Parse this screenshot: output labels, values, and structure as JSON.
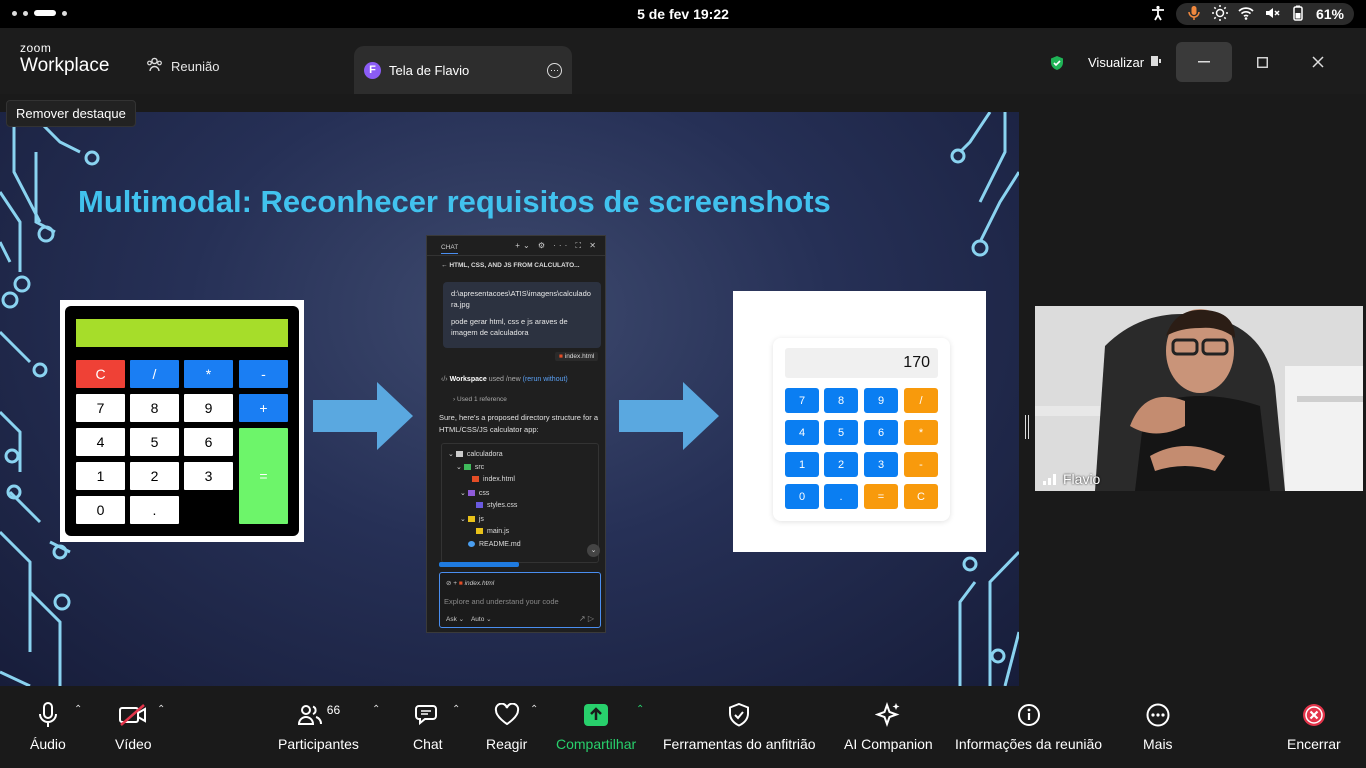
{
  "statusbar": {
    "clock": "5 de fev  19:22",
    "battery": "61%"
  },
  "titlebar": {
    "brand_small": "zoom",
    "brand_big": "Workplace",
    "tab_meeting": "Reunião",
    "tab_share_avatar": "F",
    "tab_share_label": "Tela de Flavio",
    "view_label": "Visualizar"
  },
  "tooltip": "Remover destaque",
  "slide": {
    "title": "Multimodal: Reconhecer requisitos de screenshots",
    "left_calc": {
      "keys": [
        "C",
        "/",
        "*",
        "-",
        "7",
        "8",
        "9",
        "+",
        "4",
        "5",
        "6",
        "=",
        "1",
        "2",
        "3",
        "0",
        "."
      ]
    },
    "chat": {
      "tab": "CHAT",
      "heading": "HTML, CSS, AND JS FROM CALCULATO...",
      "prompt_path": "d:\\apresentacoes\\ATIS\\imagens\\calculadora.jpg",
      "prompt_text": "pode gerar html, css e js araves de imagem de calculadora",
      "attachment": "index.html",
      "workspace": "Workspace",
      "workspace_used": "used /new",
      "workspace_link": "(rerun without)",
      "used_ref": "Used 1 reference",
      "reply": "Sure, here's a proposed directory structure for a HTML/CSS/JS calculator app:",
      "tree": [
        "calculadora",
        "src",
        "index.html",
        "css",
        "styles.css",
        "js",
        "main.js",
        "README.md"
      ],
      "input_chip": "index.html",
      "input_placeholder": "Explore and understand your code",
      "mode_ask": "Ask",
      "mode_auto": "Auto"
    },
    "right_calc": {
      "display": "170",
      "keys": [
        "7",
        "8",
        "9",
        "/",
        "4",
        "5",
        "6",
        "*",
        "1",
        "2",
        "3",
        "-",
        "0",
        ".",
        "=",
        "C"
      ]
    }
  },
  "video": {
    "name": "Flavio"
  },
  "toolbar": {
    "audio": "Áudio",
    "video": "Vídeo",
    "participants": "Participantes",
    "participants_count": "66",
    "chat": "Chat",
    "react": "Reagir",
    "share": "Compartilhar",
    "host_tools": "Ferramentas do anfitrião",
    "ai": "AI Companion",
    "info": "Informações da reunião",
    "more": "Mais",
    "end": "Encerrar"
  },
  "colors": {
    "share_green": "#28d06c",
    "slide_title": "#41c2ee",
    "end_red": "#e3344a"
  }
}
